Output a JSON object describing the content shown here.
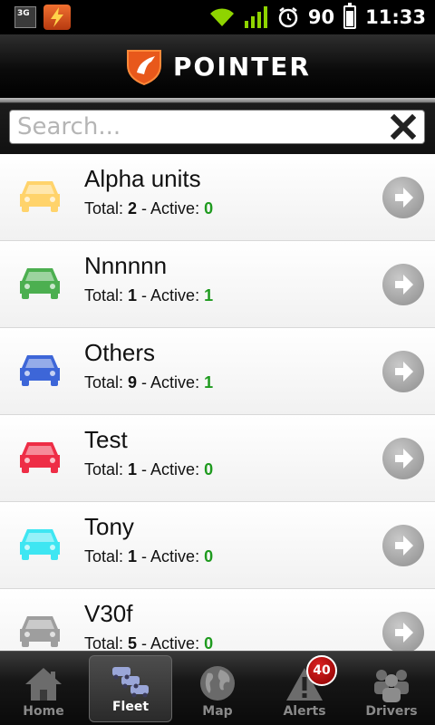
{
  "status_bar": {
    "network_badge": "3G",
    "battery_level": "90",
    "time": "11:33"
  },
  "header": {
    "brand": "POINTER"
  },
  "search": {
    "placeholder": "Search..."
  },
  "fleet": {
    "total_label": "Total: ",
    "active_label": " - Active: ",
    "groups": [
      {
        "name": "Alpha units",
        "total": "2",
        "active": "0",
        "color": "#ffd36b"
      },
      {
        "name": "Nnnnnn",
        "total": "1",
        "active": "1",
        "color": "#4caf50"
      },
      {
        "name": "Others",
        "total": "9",
        "active": "1",
        "color": "#3d66d8"
      },
      {
        "name": "Test",
        "total": "1",
        "active": "0",
        "color": "#ee2d46"
      },
      {
        "name": "Tony",
        "total": "1",
        "active": "0",
        "color": "#3ee6f2"
      },
      {
        "name": "V30f",
        "total": "5",
        "active": "0",
        "color": "#9e9e9e"
      }
    ]
  },
  "tabs": [
    {
      "label": "Home",
      "icon": "home-icon"
    },
    {
      "label": "Fleet",
      "icon": "fleet-icon"
    },
    {
      "label": "Map",
      "icon": "globe-icon"
    },
    {
      "label": "Alerts",
      "icon": "alert-icon",
      "badge": "40"
    },
    {
      "label": "Drivers",
      "icon": "drivers-icon"
    }
  ]
}
